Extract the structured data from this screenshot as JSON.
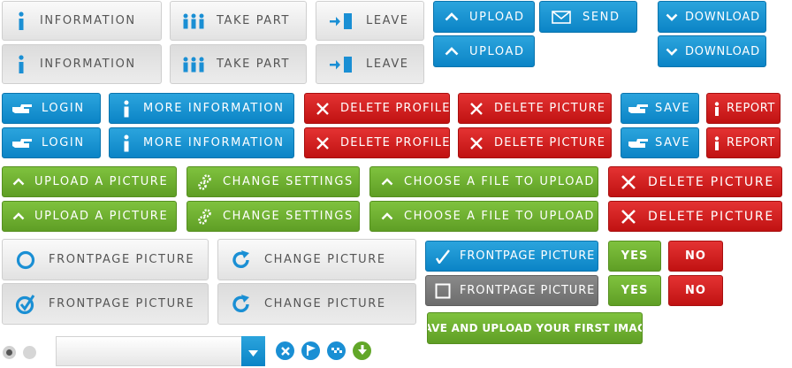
{
  "row1": {
    "information": "INFORMATION",
    "take_part": "TAKE PART",
    "leave": "LEAVE",
    "upload": "UPLOAD",
    "send": "SEND",
    "download": "DOWNLOAD"
  },
  "row2": {
    "login": "LOGIN",
    "more_information": "MORE INFORMATION",
    "delete_profile": "DELETE PROFILE",
    "delete_picture": "DELETE PICTURE",
    "save": "SAVE",
    "report": "REPORT"
  },
  "row3": {
    "upload_picture": "UPLOAD A PICTURE",
    "change_settings": "CHANGE SETTINGS",
    "choose_file": "CHOOSE A FILE TO UPLOAD",
    "delete_picture": "DELETE PICTURE"
  },
  "row4": {
    "frontpage_picture": "FRONTPAGE PICTURE",
    "change_picture": "CHANGE PICTURE",
    "yes": "YES",
    "no": "NO",
    "save_upload_first": "SAVE AND UPLOAD YOUR FIRST IMAGE"
  },
  "dropdown": {
    "value": ""
  },
  "colors": {
    "blue": "#1690d2",
    "red": "#d01f1f",
    "green": "#6dae2e",
    "gray": "#eeeeee"
  },
  "icons": [
    "info-icon",
    "people-icon",
    "exit-icon",
    "chevron-up-icon",
    "envelope-icon",
    "chevron-down-icon",
    "hand-point-icon",
    "close-x-icon",
    "gear-icon",
    "circle-icon",
    "check-circle-icon",
    "refresh-icon",
    "checkmark-icon",
    "checkbox-icon",
    "flag-icon",
    "arrow-down-icon"
  ]
}
